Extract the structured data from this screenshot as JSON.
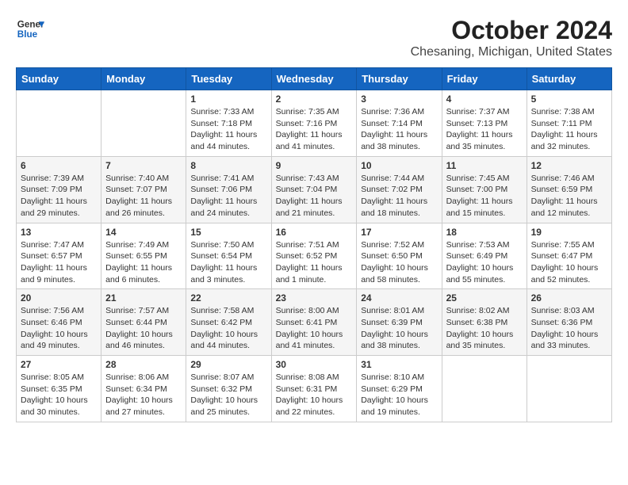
{
  "header": {
    "logo_line1": "General",
    "logo_line2": "Blue",
    "title": "October 2024",
    "subtitle": "Chesaning, Michigan, United States"
  },
  "calendar": {
    "headers": [
      "Sunday",
      "Monday",
      "Tuesday",
      "Wednesday",
      "Thursday",
      "Friday",
      "Saturday"
    ],
    "weeks": [
      [
        {
          "day": "",
          "info": ""
        },
        {
          "day": "",
          "info": ""
        },
        {
          "day": "1",
          "info": "Sunrise: 7:33 AM\nSunset: 7:18 PM\nDaylight: 11 hours and 44 minutes."
        },
        {
          "day": "2",
          "info": "Sunrise: 7:35 AM\nSunset: 7:16 PM\nDaylight: 11 hours and 41 minutes."
        },
        {
          "day": "3",
          "info": "Sunrise: 7:36 AM\nSunset: 7:14 PM\nDaylight: 11 hours and 38 minutes."
        },
        {
          "day": "4",
          "info": "Sunrise: 7:37 AM\nSunset: 7:13 PM\nDaylight: 11 hours and 35 minutes."
        },
        {
          "day": "5",
          "info": "Sunrise: 7:38 AM\nSunset: 7:11 PM\nDaylight: 11 hours and 32 minutes."
        }
      ],
      [
        {
          "day": "6",
          "info": "Sunrise: 7:39 AM\nSunset: 7:09 PM\nDaylight: 11 hours and 29 minutes."
        },
        {
          "day": "7",
          "info": "Sunrise: 7:40 AM\nSunset: 7:07 PM\nDaylight: 11 hours and 26 minutes."
        },
        {
          "day": "8",
          "info": "Sunrise: 7:41 AM\nSunset: 7:06 PM\nDaylight: 11 hours and 24 minutes."
        },
        {
          "day": "9",
          "info": "Sunrise: 7:43 AM\nSunset: 7:04 PM\nDaylight: 11 hours and 21 minutes."
        },
        {
          "day": "10",
          "info": "Sunrise: 7:44 AM\nSunset: 7:02 PM\nDaylight: 11 hours and 18 minutes."
        },
        {
          "day": "11",
          "info": "Sunrise: 7:45 AM\nSunset: 7:00 PM\nDaylight: 11 hours and 15 minutes."
        },
        {
          "day": "12",
          "info": "Sunrise: 7:46 AM\nSunset: 6:59 PM\nDaylight: 11 hours and 12 minutes."
        }
      ],
      [
        {
          "day": "13",
          "info": "Sunrise: 7:47 AM\nSunset: 6:57 PM\nDaylight: 11 hours and 9 minutes."
        },
        {
          "day": "14",
          "info": "Sunrise: 7:49 AM\nSunset: 6:55 PM\nDaylight: 11 hours and 6 minutes."
        },
        {
          "day": "15",
          "info": "Sunrise: 7:50 AM\nSunset: 6:54 PM\nDaylight: 11 hours and 3 minutes."
        },
        {
          "day": "16",
          "info": "Sunrise: 7:51 AM\nSunset: 6:52 PM\nDaylight: 11 hours and 1 minute."
        },
        {
          "day": "17",
          "info": "Sunrise: 7:52 AM\nSunset: 6:50 PM\nDaylight: 10 hours and 58 minutes."
        },
        {
          "day": "18",
          "info": "Sunrise: 7:53 AM\nSunset: 6:49 PM\nDaylight: 10 hours and 55 minutes."
        },
        {
          "day": "19",
          "info": "Sunrise: 7:55 AM\nSunset: 6:47 PM\nDaylight: 10 hours and 52 minutes."
        }
      ],
      [
        {
          "day": "20",
          "info": "Sunrise: 7:56 AM\nSunset: 6:46 PM\nDaylight: 10 hours and 49 minutes."
        },
        {
          "day": "21",
          "info": "Sunrise: 7:57 AM\nSunset: 6:44 PM\nDaylight: 10 hours and 46 minutes."
        },
        {
          "day": "22",
          "info": "Sunrise: 7:58 AM\nSunset: 6:42 PM\nDaylight: 10 hours and 44 minutes."
        },
        {
          "day": "23",
          "info": "Sunrise: 8:00 AM\nSunset: 6:41 PM\nDaylight: 10 hours and 41 minutes."
        },
        {
          "day": "24",
          "info": "Sunrise: 8:01 AM\nSunset: 6:39 PM\nDaylight: 10 hours and 38 minutes."
        },
        {
          "day": "25",
          "info": "Sunrise: 8:02 AM\nSunset: 6:38 PM\nDaylight: 10 hours and 35 minutes."
        },
        {
          "day": "26",
          "info": "Sunrise: 8:03 AM\nSunset: 6:36 PM\nDaylight: 10 hours and 33 minutes."
        }
      ],
      [
        {
          "day": "27",
          "info": "Sunrise: 8:05 AM\nSunset: 6:35 PM\nDaylight: 10 hours and 30 minutes."
        },
        {
          "day": "28",
          "info": "Sunrise: 8:06 AM\nSunset: 6:34 PM\nDaylight: 10 hours and 27 minutes."
        },
        {
          "day": "29",
          "info": "Sunrise: 8:07 AM\nSunset: 6:32 PM\nDaylight: 10 hours and 25 minutes."
        },
        {
          "day": "30",
          "info": "Sunrise: 8:08 AM\nSunset: 6:31 PM\nDaylight: 10 hours and 22 minutes."
        },
        {
          "day": "31",
          "info": "Sunrise: 8:10 AM\nSunset: 6:29 PM\nDaylight: 10 hours and 19 minutes."
        },
        {
          "day": "",
          "info": ""
        },
        {
          "day": "",
          "info": ""
        }
      ]
    ]
  }
}
